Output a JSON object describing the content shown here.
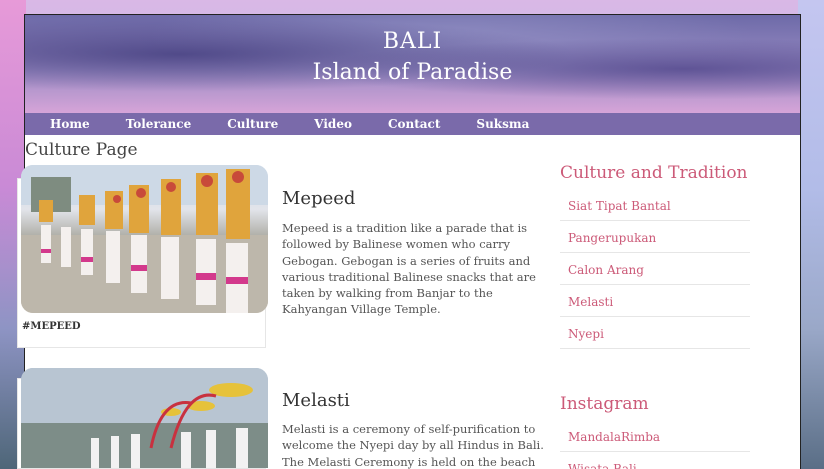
{
  "header": {
    "title_line1": "BALI",
    "title_line2": "Island of Paradise"
  },
  "nav": {
    "items": [
      "Home",
      "Tolerance",
      "Culture",
      "Video",
      "Contact",
      "Suksma"
    ]
  },
  "page_title": "Culture Page",
  "posts": [
    {
      "title": "Mepeed",
      "text": "Mepeed is a tradition like a parade that is followed by Balinese women who carry Gebogan. Gebogan is a series of fruits and various traditional Balinese snacks that are taken by walking from Banjar to the Kahyangan Village Temple.",
      "tag": "#MEPEED"
    },
    {
      "title": "Melasti",
      "text": "Melasti is a ceremony of self-purification to welcome the Nyepi day by all Hindus in Bali. The Melasti Ceremony is held on the beach"
    }
  ],
  "sidebar": {
    "culture_heading": "Culture and Tradition",
    "culture_items": [
      "Siat Tipat Bantal",
      "Pangerupukan",
      "Calon Arang",
      "Melasti",
      "Nyepi"
    ],
    "instagram_heading": "Instagram",
    "instagram_items": [
      "MandalaRimba",
      "Wisata Bali"
    ]
  },
  "colors": {
    "nav_bg": "#7a6aaa",
    "accent": "#cc5a78"
  }
}
